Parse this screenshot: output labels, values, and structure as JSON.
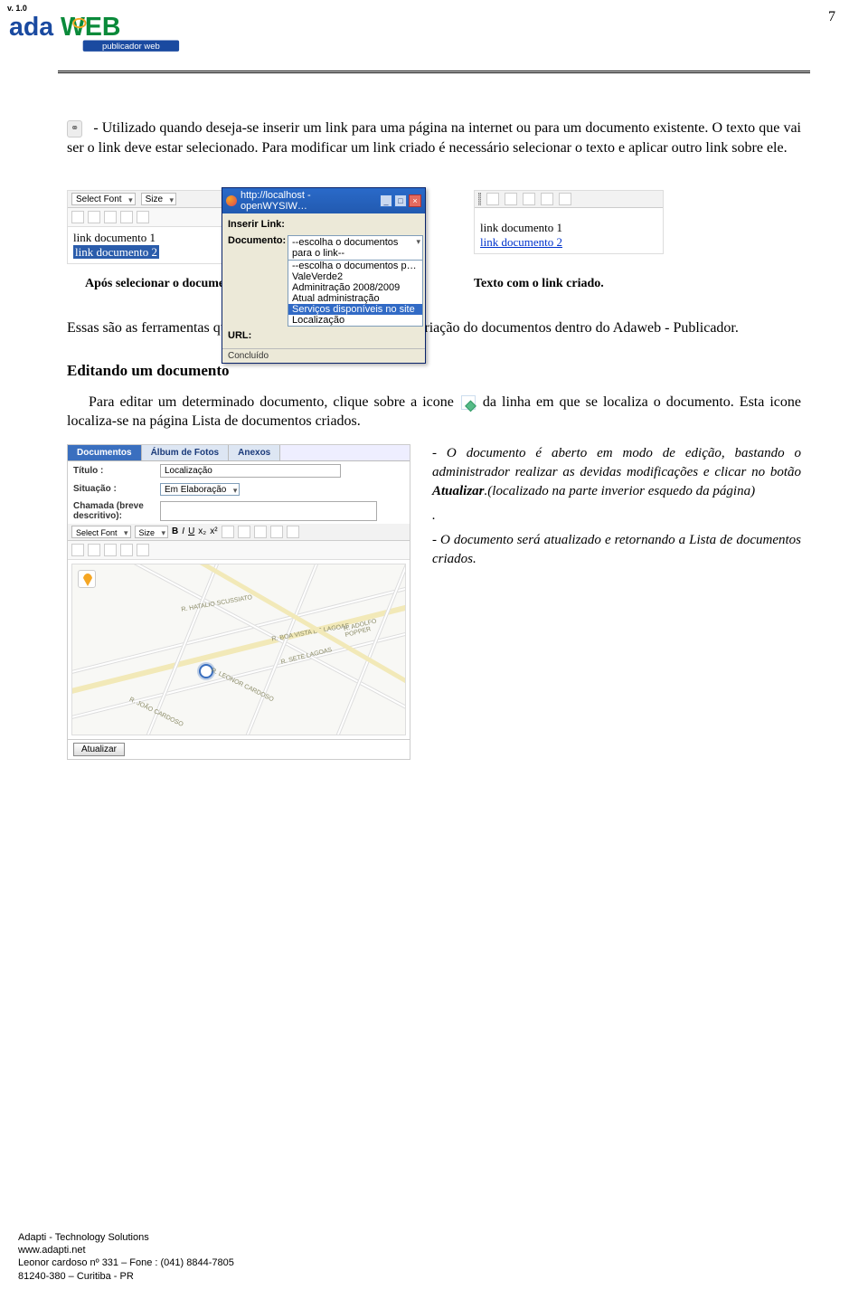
{
  "meta": {
    "version": "v. 1.0",
    "page_number": "7",
    "logo": {
      "brand_main": "adaWEB",
      "brand_sub": "publicador web"
    }
  },
  "intro": {
    "icon_label": "link-icon",
    "paragraph": " - Utilizado quando deseja-se inserir um link para uma página na internet ou para um documento existente. O texto que vai ser o link deve estar selecionado. Para modificar um link criado é necessário selecionar o texto e aplicar outro link sobre ele."
  },
  "screenshot_a": {
    "toolbar": {
      "font_label": "Select Font",
      "size_label": "Size"
    },
    "editor_lines": [
      "link documento 1",
      "link documento 2"
    ],
    "popup": {
      "title": "http://localhost - openWYSIW…",
      "heading": "Inserir Link:",
      "doc_label": "Documento:",
      "url_label": "URL:",
      "dropdown_selected": "--escolha o documentos para o link--",
      "dropdown_items": [
        "--escolha o documentos para o link--",
        "ValeVerde2",
        "Adminitração 2008/2009",
        "Atual administração",
        "Serviços disponíveis no site",
        "Localização"
      ],
      "dropdown_highlight_index": 4,
      "status": "Concluído"
    }
  },
  "screenshot_b": {
    "lines": [
      {
        "text": "link documento 1",
        "link": false
      },
      {
        "text": "link documento 2",
        "link": true
      }
    ]
  },
  "captions": {
    "a": "Após selecionar o documento, clique em Inserir Link.",
    "b": "Texto com o link criado."
  },
  "mid_paragraph": "Essas são as ferramentas que iram auxiliar o admintrador na criação do documentos dentro do Adaweb - Publicador.",
  "edit_section": {
    "heading": "Editando um documento",
    "paragraph_pre": "Para editar um determinado documento, clique sobre a icone ",
    "paragraph_post": " da linha em que se localiza o documento. Esta icone localiza-se na página Lista de documentos criados."
  },
  "edit_shot": {
    "tabs": [
      "Documentos",
      "Álbum de Fotos",
      "Anexos"
    ],
    "active_tab_index": 0,
    "fields": {
      "titulo_label": "Título :",
      "titulo_value": "Localização",
      "situacao_label": "Situação :",
      "situacao_value": "Em Elaboração",
      "chamada_label": "Chamada (breve descritivo):"
    },
    "toolbar_font": "Select Font",
    "toolbar_size": "Size",
    "map_labels": [
      "R. HATALIO SCUSSIATO",
      "R. BOA VISTA DE LAGOAS",
      "R. SETE LAGOAS",
      "R. JOÃO CARDOSO",
      "R. LEONOR CARDOSO",
      "R. ADOLFO POPPER"
    ],
    "update_button": "Atualizar"
  },
  "side_notes": {
    "n1_pre": "- O documento é aberto em modo de edição, bastando o administrador realizar as devidas modificações e clicar no botão ",
    "n1_bold": "Atualizar",
    "n1_post": ".(localizado na parte inverior esquedo da página)",
    "dot": ".",
    "n2": "- O documento será atualizado e retornando a Lista de documentos criados."
  },
  "footer": {
    "l1": "Adapti - Technology Solutions",
    "l2": "www.adapti.net",
    "l3": "Leonor cardoso nº 331 – Fone : (041) 8844-7805",
    "l4": "81240-380 – Curitiba - PR"
  }
}
